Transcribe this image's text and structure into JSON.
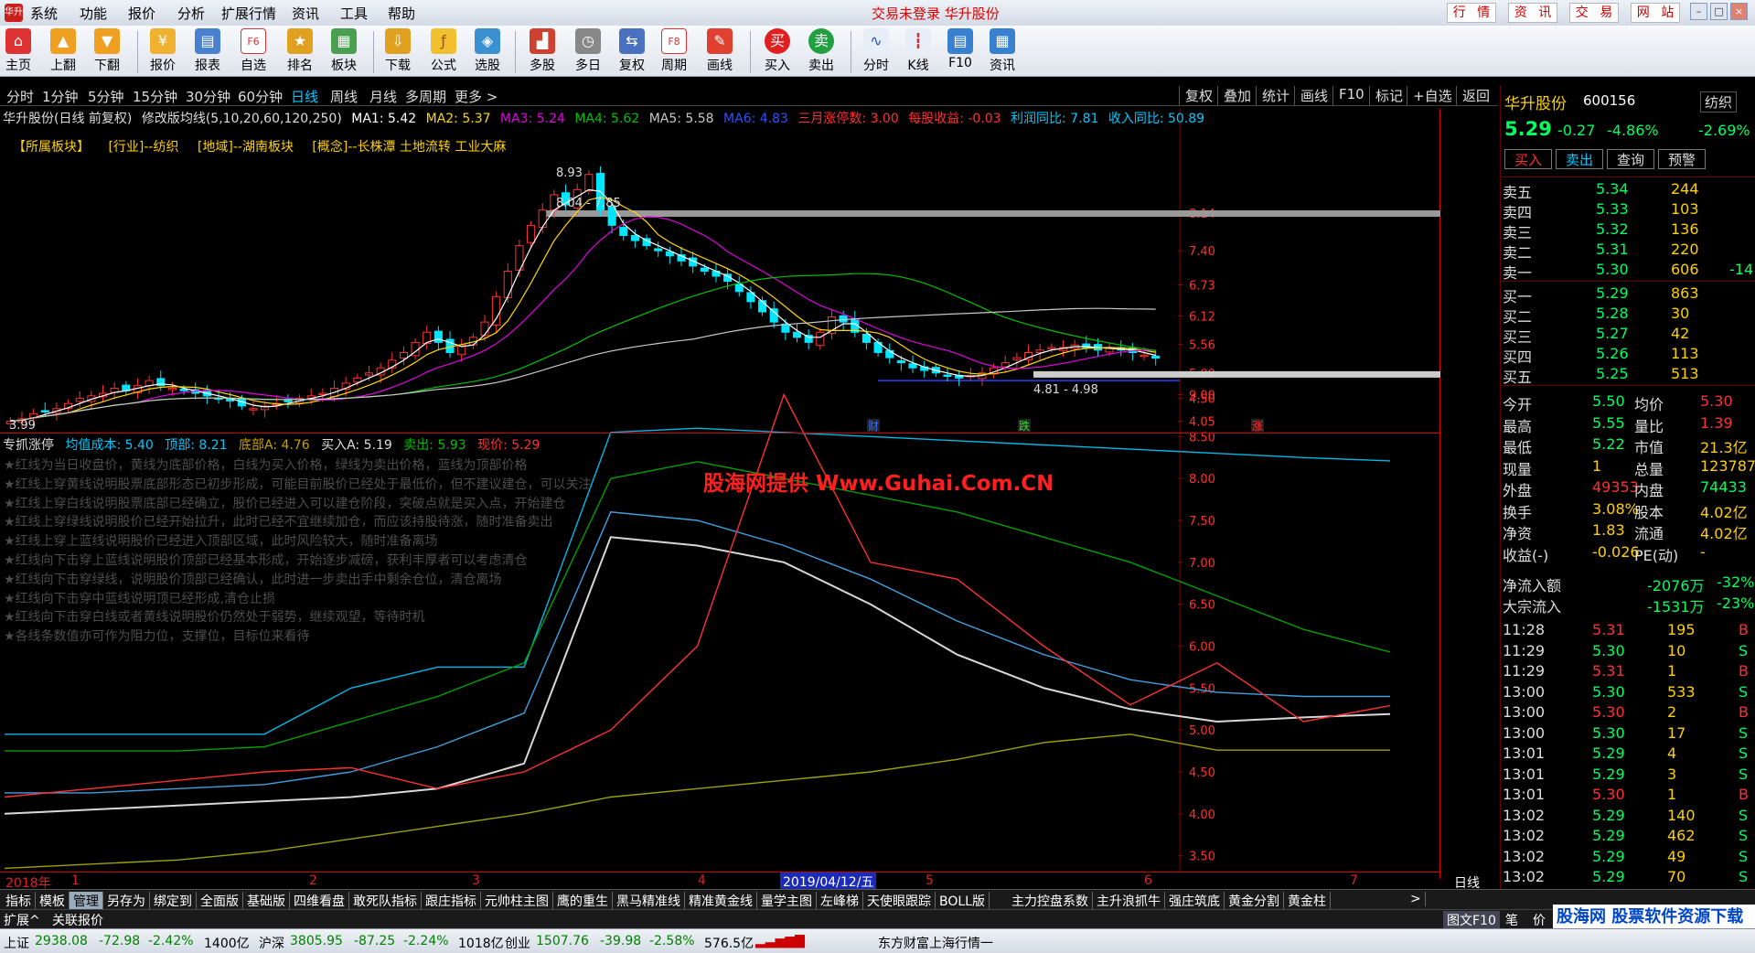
{
  "menubar": {
    "items": [
      "系统",
      "功能",
      "报价",
      "分析",
      "扩展行情",
      "资讯",
      "工具",
      "帮助"
    ],
    "center_text": "交易未登录  华升股份",
    "right_buttons": [
      "行 情",
      "资 讯",
      "交 易",
      "网 站"
    ]
  },
  "toolbar": {
    "buttons": [
      "主页",
      "上翻",
      "下翻",
      "报价",
      "报表",
      "自选",
      "排名",
      "板块",
      "下载",
      "公式",
      "选股",
      "多股",
      "多日",
      "复权",
      "周期",
      "画线",
      "买入",
      "卖出",
      "分时",
      "K线",
      "F10",
      "资讯"
    ]
  },
  "periodbar": {
    "left": [
      "分时",
      "1分钟",
      "5分钟",
      "15分钟",
      "30分钟",
      "60分钟",
      "日线",
      "周线",
      "月线",
      "多周期",
      "更多 >"
    ],
    "right": [
      "复权",
      "叠加",
      "统计",
      "画线",
      "F10",
      "标记",
      "+自选",
      "返回"
    ],
    "active": "日线"
  },
  "chart_info": {
    "name": "华升股份(日线 前复权)",
    "indicator": "修改版均线(5,10,20,60,120,250)",
    "ma1": "MA1: 5.42",
    "ma2": "MA2: 5.37",
    "ma3": "MA3: 5.24",
    "ma4": "MA4: 5.62",
    "ma5": "MA5: 5.58",
    "ma6": "MA6: 4.83",
    "limit": "三月涨停数: 3.00",
    "eps": "每股收益: -0.03",
    "profit": "利润同比: 7.81",
    "revenue": "收入同比: 50.89"
  },
  "sectors": [
    "【所属板块】",
    "[行业]--纺织",
    "[地域]--湖南板块",
    "[概念]--长株潭 土地流转 工业大麻"
  ],
  "main_axis": [
    "8.14",
    "7.40",
    "6.73",
    "6.12",
    "5.56",
    "5.00",
    "4.50",
    "4.05"
  ],
  "annotations": {
    "high": "8.93",
    "upper_zone": "8.04 - 7.85",
    "lower_zone": "4.81 - 4.98",
    "low": "3.99",
    "events": [
      "财",
      "跌",
      "涨"
    ]
  },
  "sub_header": {
    "name": "专抓涨停",
    "avg_cost": "均值成本: 5.40",
    "top": "顶部: 8.21",
    "bottom": "底部A: 4.76",
    "buy": "买入A: 5.19",
    "sell": "卖出: 5.93",
    "price": "现价: 5.29"
  },
  "notes": [
    "★红线为当日收盘价，黄线为底部价格，白线为买入价格，绿线为卖出价格，蓝线为顶部价格",
    "★红线上穿黄线说明股票底部形态已初步形成，可能目前股价已经处于最低价，但不建议建仓，可以关注",
    "★红线上穿白线说明股票底部已经确立，股价已经进入可以建仓阶段，突破点就是买入点，开始建仓",
    "★红线上穿绿线说明股价已经开始拉升，此时已经不宜继续加仓，而应该持股待涨，随时准备卖出",
    "★红线上穿上蓝线说明股价已经进入顶部区域，此时风险较大，随时准备离场",
    "★红线向下击穿上蓝线说明股价顶部已经基本形成，开始逐步减磅，获利丰厚者可以考虑清仓",
    "★红线向下击穿绿线，说明股价顶部已经确认，此时进一步卖出手中剩余仓位，清仓离场",
    "★红线向下击穿中蓝线说明顶已经形成,清仓止损",
    "★红线向下击穿白线或者黄线说明股价仍然处于弱势，继续观望，等待时机",
    "★各线条数值亦可作为阻力位，支撑位，目标位来看待"
  ],
  "watermark": "股海网提供 Www.Guhai.Com.CN",
  "sub_axis": [
    "9.00",
    "8.50",
    "8.00",
    "7.50",
    "7.00",
    "6.50",
    "6.00",
    "5.50",
    "5.00",
    "4.50",
    "4.00",
    "3.50"
  ],
  "date_axis": {
    "labels": [
      "2018年",
      "1",
      "2",
      "3",
      "4",
      "5",
      "6",
      "7"
    ],
    "selected": "2019/04/12/五",
    "period": "日线"
  },
  "tabs": [
    "指标",
    "模板",
    "管理",
    "另存为",
    "绑定到",
    "全面版",
    "基础版",
    "四维看盘",
    "敢死队指标",
    "跟庄指标",
    "元帅柱主图",
    "鹰的重生",
    "黑马精准线",
    "精准黄金线",
    "量学主图",
    "左峰梯",
    "天使眼跟踪",
    "BOLL版",
    "主力控盘系数",
    "主升浪抓牛",
    "强庄筑底",
    "黄金分割",
    "黄金柱"
  ],
  "active_tab": "管理",
  "sub_tabs": [
    "扩展^",
    "关联报价"
  ],
  "statusbar": {
    "sh": [
      "上证",
      "2938.08",
      "-72.98",
      "-2.42%",
      "1400亿"
    ],
    "hs": [
      "沪深",
      "3805.95",
      "-87.25",
      "-2.24%",
      "1018亿"
    ],
    "cy": [
      "创业",
      "1507.76",
      "-39.98",
      "-2.58%",
      "576.5亿"
    ],
    "feed": "东方财富上海行情一"
  },
  "quote": {
    "name": "华升股份",
    "code": "600156",
    "industry": "纺织",
    "price": "5.29",
    "change": "-0.27",
    "pct": "-4.86%",
    "ind_pct": "-2.69%",
    "buttons": [
      "买入",
      "卖出",
      "查询",
      "预警"
    ],
    "asks": [
      [
        "卖五",
        "5.34",
        "244",
        ""
      ],
      [
        "卖四",
        "5.33",
        "103",
        ""
      ],
      [
        "卖三",
        "5.32",
        "136",
        ""
      ],
      [
        "卖二",
        "5.31",
        "220",
        ""
      ],
      [
        "卖一",
        "5.30",
        "606",
        "-14"
      ]
    ],
    "bids": [
      [
        "买一",
        "5.29",
        "863"
      ],
      [
        "买二",
        "5.28",
        "30"
      ],
      [
        "买三",
        "5.27",
        "42"
      ],
      [
        "买四",
        "5.26",
        "113"
      ],
      [
        "买五",
        "5.25",
        "513"
      ]
    ],
    "stats": [
      [
        "今开",
        "5.50",
        "均价",
        "5.30"
      ],
      [
        "最高",
        "5.55",
        "量比",
        "1.39"
      ],
      [
        "最低",
        "5.22",
        "市值",
        "21.3亿"
      ],
      [
        "现量",
        "1",
        "总量",
        "123787"
      ],
      [
        "外盘",
        "49353",
        "内盘",
        "74433"
      ],
      [
        "换手",
        "3.08%",
        "股本",
        "4.02亿"
      ],
      [
        "净资",
        "1.83",
        "流通",
        "4.02亿"
      ],
      [
        "收益(-)",
        "-0.026",
        "PE(动)",
        "-"
      ]
    ],
    "flows": [
      [
        "净流入额",
        "-2076万",
        "-32%"
      ],
      [
        "大宗流入",
        "-1531万",
        "-23%"
      ]
    ],
    "ticks": [
      [
        "11:28",
        "5.31",
        "195",
        "B"
      ],
      [
        "11:29",
        "5.30",
        "10",
        "S"
      ],
      [
        "11:29",
        "5.31",
        "1",
        "B"
      ],
      [
        "13:00",
        "5.30",
        "533",
        "S"
      ],
      [
        "13:00",
        "5.30",
        "2",
        "B"
      ],
      [
        "13:00",
        "5.30",
        "17",
        "S"
      ],
      [
        "13:01",
        "5.29",
        "4",
        "S"
      ],
      [
        "13:01",
        "5.29",
        "3",
        "S"
      ],
      [
        "13:01",
        "5.30",
        "1",
        "B"
      ],
      [
        "13:02",
        "5.29",
        "140",
        "S"
      ],
      [
        "13:02",
        "5.29",
        "462",
        "S"
      ],
      [
        "13:02",
        "5.29",
        "49",
        "S"
      ],
      [
        "13:02",
        "5.29",
        "70",
        "S"
      ]
    ]
  },
  "corner_logo": "股海网 股票软件资源下载",
  "corner_tabs": [
    "图文F10",
    "笔",
    "价"
  ],
  "colors": {
    "up": "#ff3030",
    "down": "#00e6ff",
    "ma1": "#ffffff",
    "ma2": "#ffd700",
    "ma3": "#e000e0",
    "ma4": "#00c000",
    "ma5": "#c8c8c8",
    "ma6": "#3050ff"
  },
  "chart_data": {
    "type": "candlestick",
    "main_price_range": [
      3.9,
      9.2
    ],
    "candle_closes": [
      4.05,
      4.1,
      4.2,
      4.25,
      4.3,
      4.4,
      4.5,
      4.55,
      4.6,
      4.7,
      4.65,
      4.75,
      4.85,
      4.75,
      4.7,
      4.65,
      4.6,
      4.55,
      4.5,
      4.45,
      4.35,
      4.3,
      4.35,
      4.4,
      4.45,
      4.5,
      4.55,
      4.6,
      4.7,
      4.8,
      4.9,
      5.0,
      5.1,
      5.25,
      5.4,
      5.6,
      5.8,
      5.6,
      5.4,
      5.55,
      5.7,
      6.0,
      6.5,
      7.0,
      7.5,
      7.9,
      8.2,
      8.5,
      8.3,
      8.6,
      8.9,
      8.2,
      7.9,
      7.7,
      7.6,
      7.5,
      7.4,
      7.3,
      7.2,
      7.1,
      7.0,
      6.9,
      6.8,
      6.6,
      6.4,
      6.2,
      6.0,
      5.8,
      5.7,
      5.6,
      5.8,
      6.1,
      6.0,
      5.8,
      5.6,
      5.4,
      5.3,
      5.2,
      5.1,
      5.05,
      5.0,
      4.95,
      4.9,
      4.95,
      5.0,
      5.1,
      5.2,
      5.3,
      5.4,
      5.45,
      5.5,
      5.5,
      5.55,
      5.5,
      5.45,
      5.5,
      5.45,
      5.4,
      5.35,
      5.29
    ],
    "sub_price_range": [
      3.3,
      9.3
    ],
    "series": [
      {
        "name": "顶部",
        "values": [
          4.95,
          4.95,
          4.95,
          4.95,
          5.5,
          5.75,
          5.75,
          8.55,
          8.6,
          8.55,
          8.5,
          8.45,
          8.4,
          8.35,
          8.3,
          8.25,
          8.21
        ]
      },
      {
        "name": "卖出",
        "values": [
          4.75,
          4.75,
          4.75,
          4.8,
          5.1,
          5.4,
          5.8,
          8.0,
          8.2,
          8.0,
          7.8,
          7.6,
          7.3,
          7.0,
          6.6,
          6.2,
          5.93
        ]
      },
      {
        "name": "均值成本",
        "values": [
          4.25,
          4.25,
          4.3,
          4.35,
          4.5,
          4.8,
          5.2,
          7.6,
          7.5,
          7.2,
          6.8,
          6.3,
          5.9,
          5.6,
          5.45,
          5.4,
          5.4
        ]
      },
      {
        "name": "买入A",
        "values": [
          4.0,
          4.05,
          4.1,
          4.15,
          4.2,
          4.3,
          4.6,
          7.3,
          7.2,
          7.0,
          6.5,
          5.9,
          5.5,
          5.25,
          5.1,
          5.15,
          5.19
        ]
      },
      {
        "name": "底部A",
        "values": [
          3.35,
          3.4,
          3.45,
          3.55,
          3.7,
          3.85,
          4.0,
          4.2,
          4.3,
          4.4,
          4.5,
          4.65,
          4.85,
          4.95,
          4.76,
          4.76,
          4.76
        ]
      },
      {
        "name": "现价",
        "values": [
          4.2,
          4.3,
          4.4,
          4.5,
          4.55,
          4.3,
          4.5,
          5.0,
          6.0,
          9.0,
          7.0,
          6.8,
          6.0,
          5.3,
          5.8,
          5.1,
          5.29
        ]
      }
    ]
  }
}
